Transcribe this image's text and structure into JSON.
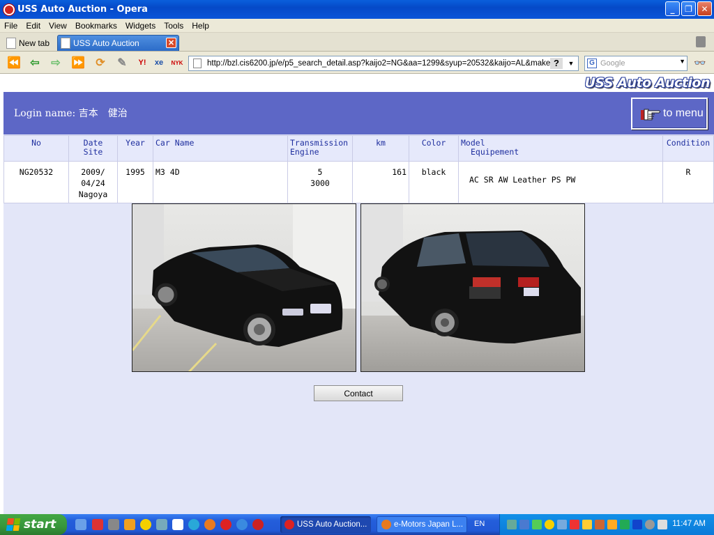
{
  "window": {
    "title": "USS Auto Auction - Opera"
  },
  "menubar": [
    "File",
    "Edit",
    "View",
    "Bookmarks",
    "Widgets",
    "Tools",
    "Help"
  ],
  "tabs": {
    "new_tab": "New tab",
    "active_tab": "USS Auto Auction"
  },
  "address": {
    "url": "http://bzl.cis6200.jp/e/p5_search_detail.asp?kaijo2=NG&aa=1299&syup=20532&kaijo=AL&maker=0"
  },
  "search": {
    "engine": "Google",
    "placeholder": "Google"
  },
  "page": {
    "logo": "USS Auto Auction",
    "login_label": "Login name: 吉本　健治",
    "to_menu": "to menu",
    "table": {
      "headers": {
        "no": "No",
        "date": "Date",
        "site": "Site",
        "year": "Year",
        "car_name": "Car Name",
        "transmission": "Transmission",
        "engine": "Engine",
        "km": "km",
        "color": "Color",
        "model": "Model",
        "equipment": "Equipement",
        "condition": "Condition"
      },
      "row": {
        "no": "NG20532",
        "date_line1": "2009/",
        "date_line2": "04/24",
        "site": "Nagoya",
        "year": "1995",
        "car_name": "M3 4D",
        "transmission": "5",
        "engine": "3000",
        "km": "161",
        "color": "black",
        "equipment": "AC SR AW Leather PS PW",
        "condition": "R"
      }
    },
    "contact_button": "Contact"
  },
  "taskbar": {
    "start": "start",
    "tasks": [
      "USS Auto Auction...",
      "e-Motors Japan L..."
    ],
    "lang": "EN",
    "clock": "11:47 AM"
  },
  "colors": {
    "band": "#5d67c6",
    "page_bg": "#e3e6f8",
    "header_text": "#1f2f9f",
    "taskbar": "#245edb",
    "start": "#37963b"
  }
}
